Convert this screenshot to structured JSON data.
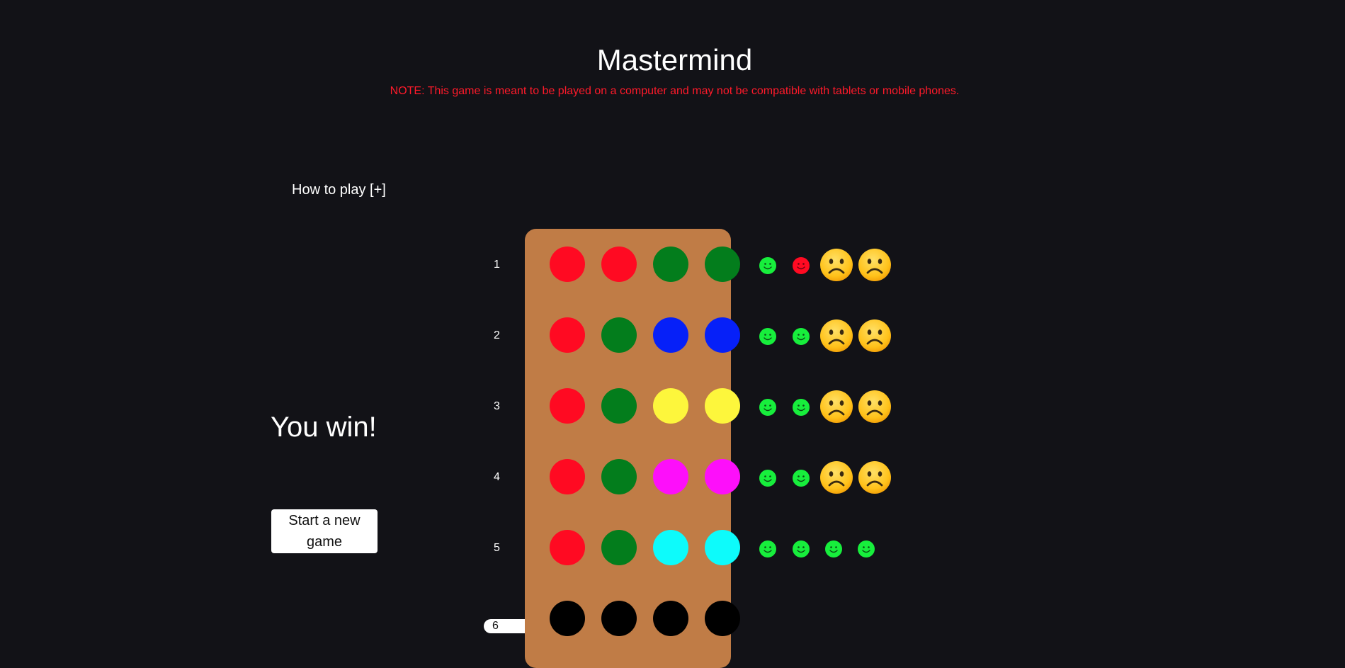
{
  "header": {
    "title": "Mastermind",
    "note": "NOTE: This game is meant to be played on a computer and may not be compatible with tablets or mobile phones."
  },
  "sidebar": {
    "how_to_play": "How to play [+]",
    "status": "You win!",
    "new_game_label": "Start a new game"
  },
  "colors": {
    "red": "#ff0a22",
    "green": "#037d1c",
    "blue": "#0620f8",
    "yellow": "#fdf63c",
    "magenta": "#fd0ffa",
    "cyan": "#0dfbfb",
    "empty": "#000000",
    "board": "#c07c46",
    "feedback_exact": "#17ee3c",
    "feedback_color": "#ff0a22"
  },
  "rows": [
    {
      "number": "1",
      "pegs": [
        "red",
        "red",
        "green",
        "green"
      ],
      "feedback": [
        "exact-smiley-icon",
        "color-smiley-icon",
        "frowning-face-icon",
        "frowning-face-icon"
      ]
    },
    {
      "number": "2",
      "pegs": [
        "red",
        "green",
        "blue",
        "blue"
      ],
      "feedback": [
        "exact-smiley-icon",
        "exact-smiley-icon",
        "frowning-face-icon",
        "frowning-face-icon"
      ]
    },
    {
      "number": "3",
      "pegs": [
        "red",
        "green",
        "yellow",
        "yellow"
      ],
      "feedback": [
        "exact-smiley-icon",
        "exact-smiley-icon",
        "frowning-face-icon",
        "frowning-face-icon"
      ]
    },
    {
      "number": "4",
      "pegs": [
        "red",
        "green",
        "magenta",
        "magenta"
      ],
      "feedback": [
        "exact-smiley-icon",
        "exact-smiley-icon",
        "frowning-face-icon",
        "frowning-face-icon"
      ]
    },
    {
      "number": "5",
      "pegs": [
        "red",
        "green",
        "cyan",
        "cyan"
      ],
      "feedback": [
        "exact-smiley-icon",
        "exact-smiley-icon",
        "exact-smiley-icon",
        "exact-smiley-icon"
      ]
    },
    {
      "number": "6",
      "pegs": [
        "empty",
        "empty",
        "empty",
        "empty"
      ],
      "feedback": [],
      "active": true
    }
  ]
}
